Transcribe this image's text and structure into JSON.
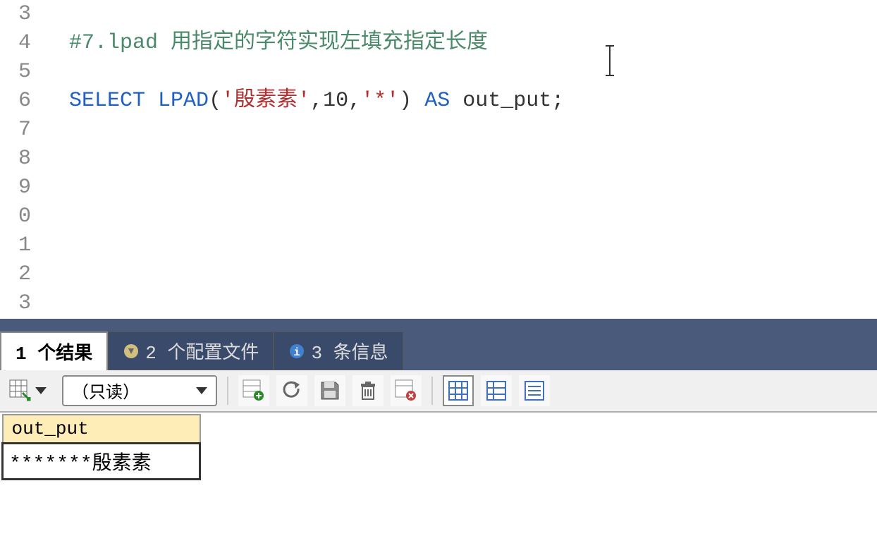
{
  "editor": {
    "line_numbers": [
      "3",
      "4",
      "5",
      "6",
      "7",
      "8",
      "9",
      "0",
      "1",
      "2",
      "3"
    ],
    "lines": {
      "comment": "#7.lpad 用指定的字符实现左填充指定长度",
      "sql": {
        "select": "SELECT",
        "lpad": "LPAD",
        "paren_open": "(",
        "str1": "'殷素素'",
        "comma1": ",",
        "num": "10",
        "comma2": ",",
        "str2": "'*'",
        "paren_close": ")",
        "as": "AS",
        "alias": "out_put",
        "semi": ";"
      }
    }
  },
  "tabs": {
    "results": "1 个结果",
    "profiles": "2 个配置文件",
    "messages": "3 条信息"
  },
  "toolbar": {
    "readonly": "（只读）"
  },
  "result": {
    "header": "out_put",
    "value": "*******殷素素"
  }
}
